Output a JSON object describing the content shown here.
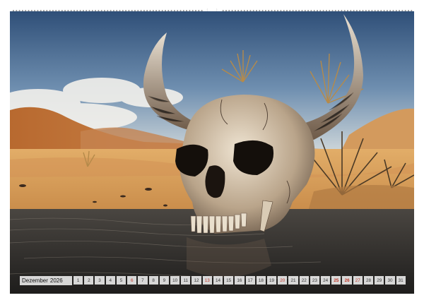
{
  "calendar": {
    "month": "Dezember",
    "year": "2026",
    "days": [
      {
        "n": "1",
        "kind": "weekday"
      },
      {
        "n": "2",
        "kind": "weekday"
      },
      {
        "n": "3",
        "kind": "weekday"
      },
      {
        "n": "4",
        "kind": "weekday"
      },
      {
        "n": "5",
        "kind": "weekday"
      },
      {
        "n": "6",
        "kind": "weekend"
      },
      {
        "n": "7",
        "kind": "weekday"
      },
      {
        "n": "8",
        "kind": "weekday"
      },
      {
        "n": "9",
        "kind": "weekday"
      },
      {
        "n": "10",
        "kind": "weekday"
      },
      {
        "n": "11",
        "kind": "weekday"
      },
      {
        "n": "12",
        "kind": "weekday"
      },
      {
        "n": "13",
        "kind": "weekend"
      },
      {
        "n": "14",
        "kind": "weekday"
      },
      {
        "n": "15",
        "kind": "weekday"
      },
      {
        "n": "16",
        "kind": "weekday"
      },
      {
        "n": "17",
        "kind": "weekday"
      },
      {
        "n": "18",
        "kind": "weekday"
      },
      {
        "n": "19",
        "kind": "weekday"
      },
      {
        "n": "20",
        "kind": "weekend"
      },
      {
        "n": "21",
        "kind": "weekday"
      },
      {
        "n": "22",
        "kind": "weekday"
      },
      {
        "n": "23",
        "kind": "weekday"
      },
      {
        "n": "24",
        "kind": "weekday"
      },
      {
        "n": "25",
        "kind": "holiday"
      },
      {
        "n": "26",
        "kind": "holiday"
      },
      {
        "n": "27",
        "kind": "weekend"
      },
      {
        "n": "28",
        "kind": "weekday"
      },
      {
        "n": "29",
        "kind": "weekday"
      },
      {
        "n": "30",
        "kind": "weekday"
      },
      {
        "n": "31",
        "kind": "weekday"
      }
    ]
  },
  "colors": {
    "weekend": "#c0392b",
    "sky_top": "#2f4f78",
    "sand": "#d9a05b",
    "water": "#2b2a29"
  }
}
